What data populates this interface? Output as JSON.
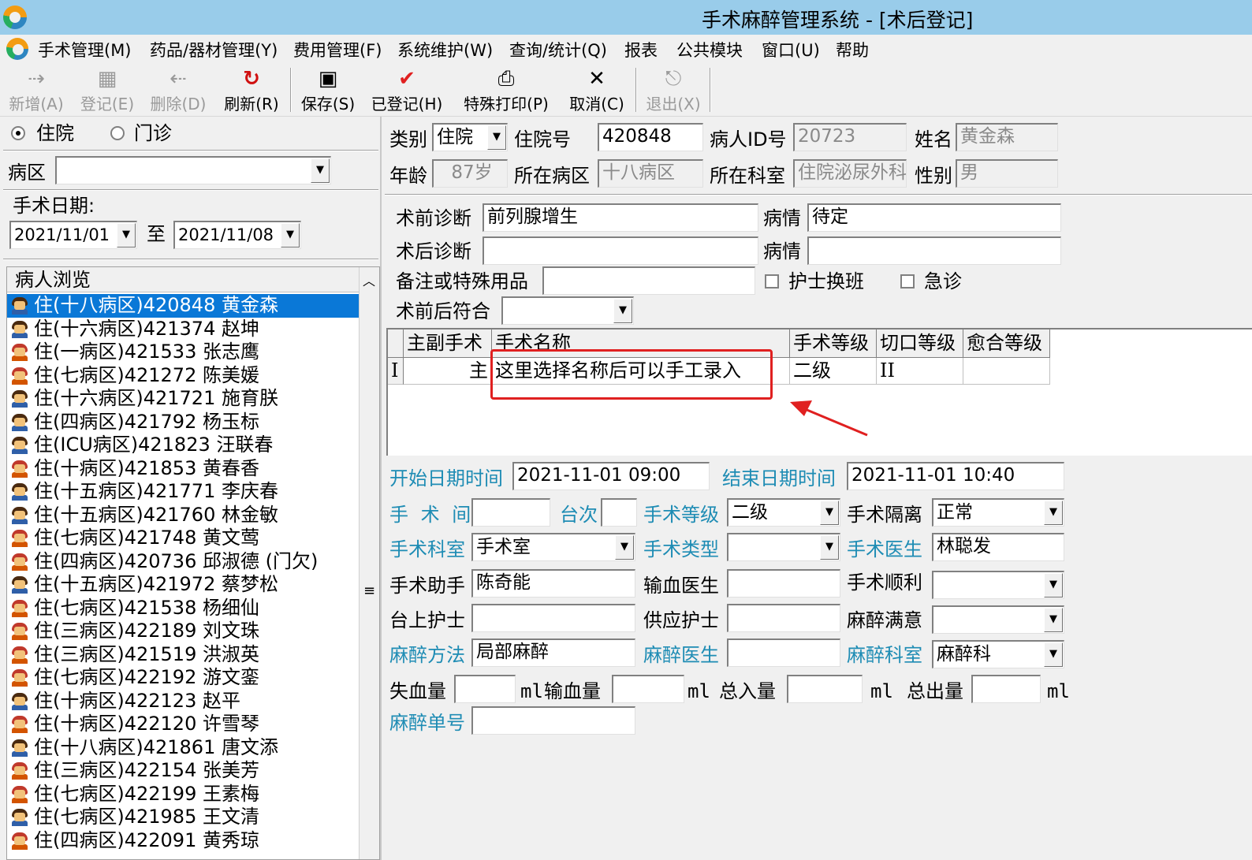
{
  "window": {
    "title": "手术麻醉管理系统 - [术后登记]"
  },
  "menu": [
    "手术管理(M)",
    "药品/器材管理(Y)",
    "费用管理(F)",
    "系统维护(W)",
    "查询/统计(Q)",
    "报表",
    "公共模块",
    "窗口(U)",
    "帮助"
  ],
  "toolbar": {
    "add": "新增(A)",
    "register": "登记(E)",
    "delete": "删除(D)",
    "refresh": "刷新(R)",
    "save": "保存(S)",
    "registered": "已登记(H)",
    "special_print": "特殊打印(P)",
    "cancel": "取消(C)",
    "exit": "退出(X)"
  },
  "left": {
    "radio_inpatient": "住院",
    "radio_outpatient": "门诊",
    "ward_label": "病区",
    "ward_value": "",
    "date_label": "手术日期:",
    "date_from": "2021/11/01",
    "date_to_label": "至",
    "date_to": "2021/11/08",
    "browse_header": "病人浏览",
    "patients": [
      {
        "text": "住(十八病区)420848  黄金森",
        "g": "m"
      },
      {
        "text": "住(十六病区)421374  赵坤",
        "g": "m"
      },
      {
        "text": "住(一病区)421533  张志鹰",
        "g": "f"
      },
      {
        "text": "住(七病区)421272  陈美媛",
        "g": "f"
      },
      {
        "text": "住(十六病区)421721  施育朕",
        "g": "m"
      },
      {
        "text": "住(四病区)421792  杨玉标",
        "g": "m"
      },
      {
        "text": "住(ICU病区)421823  汪联春",
        "g": "m"
      },
      {
        "text": "住(十病区)421853  黄春香",
        "g": "f"
      },
      {
        "text": "住(十五病区)421771  李庆春",
        "g": "m"
      },
      {
        "text": "住(十五病区)421760  林金敏",
        "g": "m"
      },
      {
        "text": "住(七病区)421748  黄文莺",
        "g": "f"
      },
      {
        "text": "住(四病区)420736  邱淑德 (门欠)",
        "g": "f"
      },
      {
        "text": "住(十五病区)421972  蔡梦松",
        "g": "m"
      },
      {
        "text": "住(七病区)421538  杨细仙",
        "g": "f"
      },
      {
        "text": "住(三病区)422189  刘文珠",
        "g": "f"
      },
      {
        "text": "住(三病区)421519  洪淑英",
        "g": "f"
      },
      {
        "text": "住(七病区)422192  游文銮",
        "g": "f"
      },
      {
        "text": "住(十病区)422123  赵平",
        "g": "m"
      },
      {
        "text": "住(十病区)422120  许雪琴",
        "g": "f"
      },
      {
        "text": "住(十八病区)421861  唐文添",
        "g": "m"
      },
      {
        "text": "住(三病区)422154  张美芳",
        "g": "f"
      },
      {
        "text": "住(七病区)422199  王素梅",
        "g": "f"
      },
      {
        "text": "住(七病区)421985  王文清",
        "g": "m"
      },
      {
        "text": "住(四病区)422091  黄秀琼",
        "g": "f"
      }
    ]
  },
  "info": {
    "category_label": "类别",
    "category_value": "住院",
    "admission_label": "住院号",
    "admission_value": "420848",
    "pid_label": "病人ID号",
    "pid_value": "20723",
    "name_label": "姓名",
    "name_value": "黄金森",
    "age_label": "年龄",
    "age_value": "87岁",
    "ward_label": "所在病区",
    "ward_value": "十八病区",
    "dept_label": "所在科室",
    "dept_value": "住院泌尿外科",
    "sex_label": "性别",
    "sex_value": "男"
  },
  "diag": {
    "pre_label": "术前诊断",
    "pre_value": "前列腺增生",
    "cond_label": "病情",
    "cond_value": "待定",
    "post_label": "术后诊断",
    "post_value": "",
    "cond2_label": "病情",
    "cond2_value": "",
    "remark_label": "备注或特殊用品",
    "remark_value": "",
    "nurse_shift": "护士换班",
    "emergency": "急诊",
    "match_label": "术前后符合",
    "match_value": ""
  },
  "grid": {
    "headers": [
      "主副手术",
      "手术名称",
      "手术等级",
      "切口等级",
      "愈合等级"
    ],
    "row": {
      "marker": "I",
      "type": "主",
      "name": "这里选择名称后可以手工录入",
      "level": "二级",
      "incision": "II",
      "healing": ""
    }
  },
  "form": {
    "start_label": "开始日期时间",
    "start_value": "2021-11-01  09:00",
    "end_label": "结束日期时间",
    "end_value": "2021-11-01  10:40",
    "room_label": "手 术 间",
    "room_value": "",
    "table_label": "台次",
    "table_value": "",
    "level_label": "手术等级",
    "level_value": "二级",
    "isolation_label": "手术隔离",
    "isolation_value": "正常",
    "dept_label": "手术科室",
    "dept_value": "手术室",
    "type_label": "手术类型",
    "type_value": "",
    "surgeon_label": "手术医生",
    "surgeon_value": "林聪发",
    "assistant_label": "手术助手",
    "assistant_value": "陈奇能",
    "transfusion_doc_label": "输血医生",
    "transfusion_doc_value": "",
    "smooth_label": "手术顺利",
    "smooth_value": "",
    "scrub_nurse_label": "台上护士",
    "scrub_nurse_value": "",
    "supply_nurse_label": "供应护士",
    "supply_nurse_value": "",
    "anes_satisfaction_label": "麻醉满意",
    "anes_satisfaction_value": "",
    "anes_method_label": "麻醉方法",
    "anes_method_value": "局部麻醉",
    "anes_doc_label": "麻醉医生",
    "anes_doc_value": "",
    "anes_dept_label": "麻醉科室",
    "anes_dept_value": "麻醉科",
    "blood_loss_label": "失血量",
    "blood_loss_value": "",
    "ml": "ml",
    "transfusion_label": "输血量",
    "transfusion_value": "",
    "total_in_label": "总入量",
    "total_in_value": "",
    "total_out_label": "总出量",
    "total_out_value": "",
    "anes_no_label": "麻醉单号",
    "anes_no_value": ""
  },
  "colors": {
    "titlebar": "#99ccea",
    "selection": "#0a78d7",
    "field_label_teal": "#1e8cb4",
    "annotation_red": "#e02020"
  }
}
